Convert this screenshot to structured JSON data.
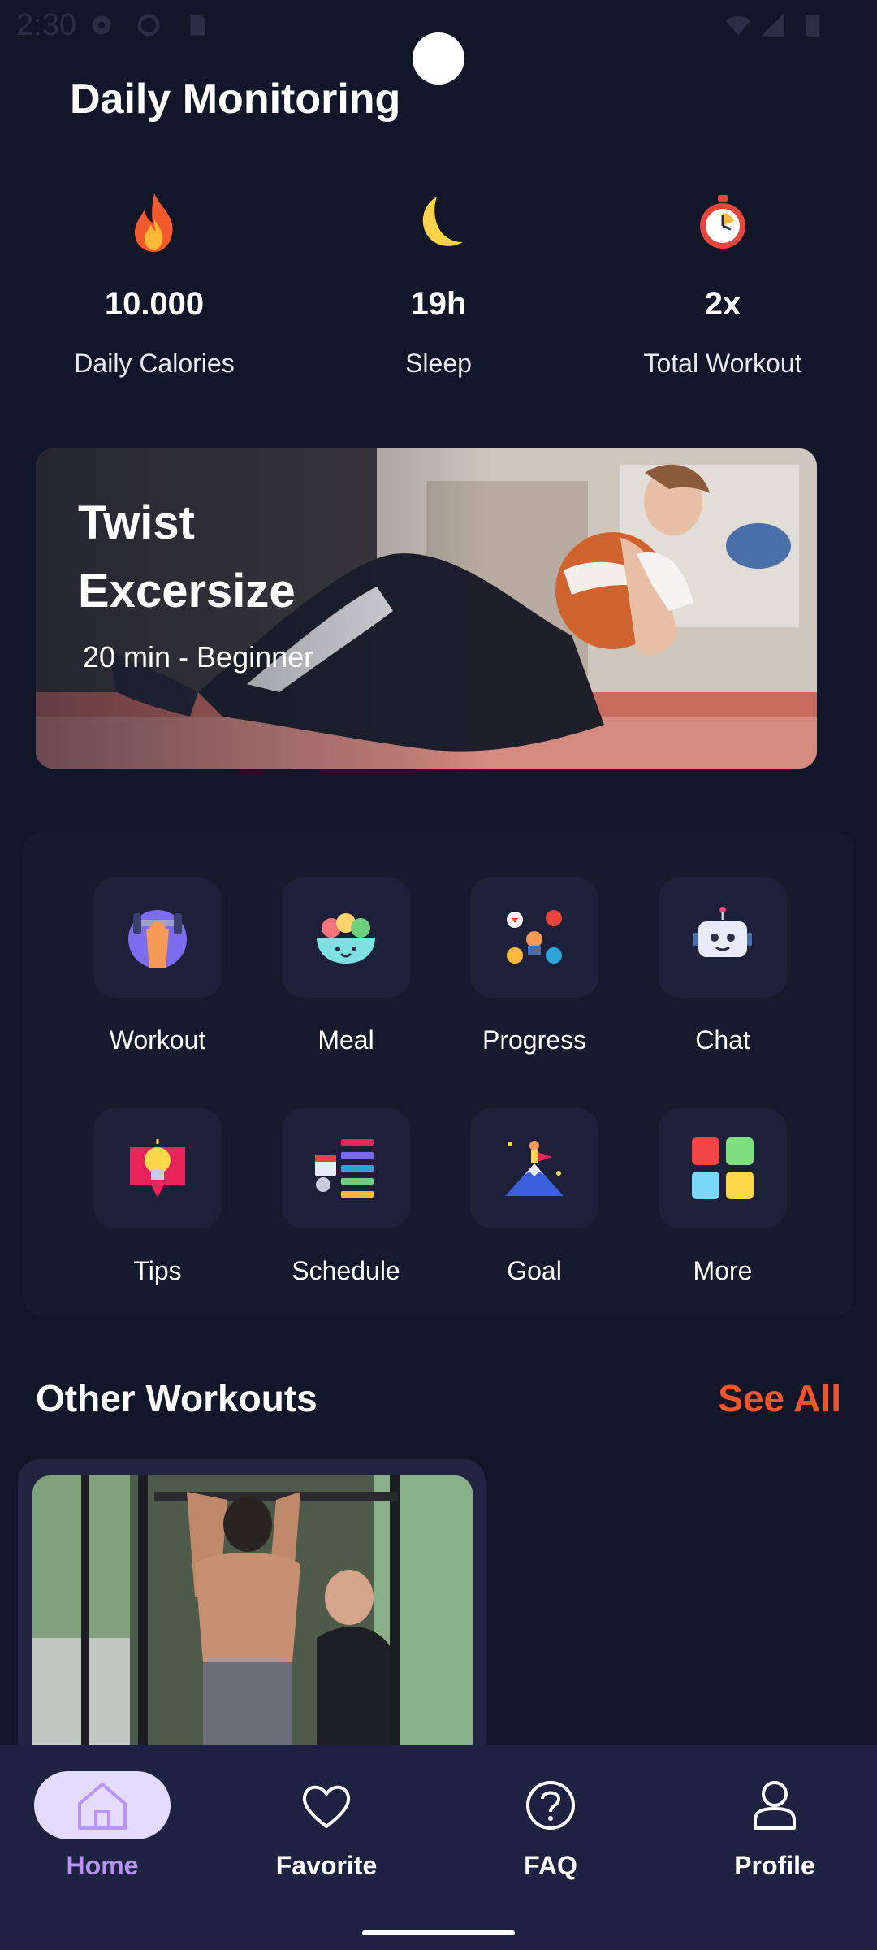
{
  "status_bar": {
    "time": "2:30",
    "icons": [
      "gear-icon",
      "settings-icon",
      "sim-card-icon",
      "wifi-icon",
      "signal-icon",
      "battery-icon"
    ]
  },
  "header": {
    "title": "Daily Monitoring"
  },
  "stats": [
    {
      "icon": "flame-icon",
      "value": "10.000",
      "label": "Daily Calories"
    },
    {
      "icon": "moon-icon",
      "value": "19h",
      "label": "Sleep"
    },
    {
      "icon": "stopwatch-icon",
      "value": "2x",
      "label": "Total Workout"
    }
  ],
  "hero": {
    "title": "Twist Excersize",
    "subtitle": "20 min - Beginner"
  },
  "features": [
    {
      "label": "Workout",
      "icon": "dumbbell-icon"
    },
    {
      "label": "Meal",
      "icon": "salad-bowl-icon"
    },
    {
      "label": "Progress",
      "icon": "progress-people-icon"
    },
    {
      "label": "Chat",
      "icon": "robot-icon"
    },
    {
      "label": "Tips",
      "icon": "lightbulb-icon"
    },
    {
      "label": "Schedule",
      "icon": "calendar-list-icon"
    },
    {
      "label": "Goal",
      "icon": "mountain-flag-icon"
    },
    {
      "label": "More",
      "icon": "grid-icon"
    }
  ],
  "other_workouts": {
    "title": "Other Workouts",
    "see_all": "See All"
  },
  "bottom_nav": [
    {
      "label": "Home",
      "icon": "home-icon",
      "active": true
    },
    {
      "label": "Favorite",
      "icon": "heart-icon",
      "active": false
    },
    {
      "label": "FAQ",
      "icon": "help-circle-icon",
      "active": false
    },
    {
      "label": "Profile",
      "icon": "user-icon",
      "active": false
    }
  ],
  "colors": {
    "background": "#121629",
    "accent": "#f2552c",
    "nav_active": "#b794f6",
    "nav_background": "#1d2240"
  }
}
